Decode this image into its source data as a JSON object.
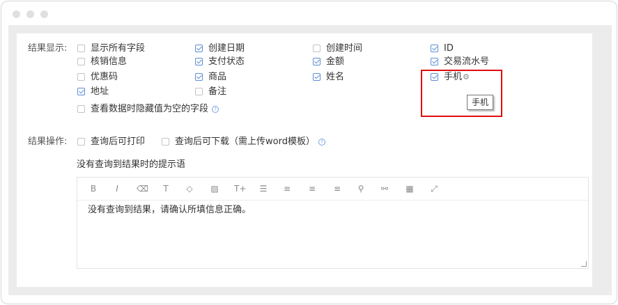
{
  "display": {
    "label": "结果显示:",
    "fields": [
      {
        "label": "显示所有字段",
        "checked": false
      },
      {
        "label": "创建日期",
        "checked": true
      },
      {
        "label": "创建时间",
        "checked": false
      },
      {
        "label": "ID",
        "checked": true
      },
      {
        "label": "核销信息",
        "checked": false
      },
      {
        "label": "支付状态",
        "checked": true
      },
      {
        "label": "金额",
        "checked": true
      },
      {
        "label": "交易流水号",
        "checked": true
      },
      {
        "label": "优惠码",
        "checked": false
      },
      {
        "label": "商品",
        "checked": true
      },
      {
        "label": "姓名",
        "checked": true
      },
      {
        "label": "手机",
        "checked": true
      },
      {
        "label": "地址",
        "checked": true
      },
      {
        "label": "备注",
        "checked": false
      }
    ],
    "hide_empty": {
      "label": "查看数据时隐藏值为空的字段",
      "checked": false
    },
    "tooltip": "手机"
  },
  "operations": {
    "label": "结果操作:",
    "print": {
      "label": "查询后可打印",
      "checked": false
    },
    "download": {
      "label": "查询后可下载（需上传word模板）",
      "checked": false
    }
  },
  "empty_hint": {
    "label": "没有查询到结果时的提示语",
    "content": "没有查询到结果，请确认所填信息正确。",
    "toolbar": [
      "bold-icon",
      "italic-icon",
      "eraser-icon",
      "text-format-icon",
      "fill-color-icon",
      "image-icon",
      "font-size-icon",
      "list-icon",
      "align-left-icon",
      "align-center-icon",
      "align-right-icon",
      "link-icon",
      "unlink-icon",
      "table-icon",
      "fullscreen-icon"
    ]
  }
}
